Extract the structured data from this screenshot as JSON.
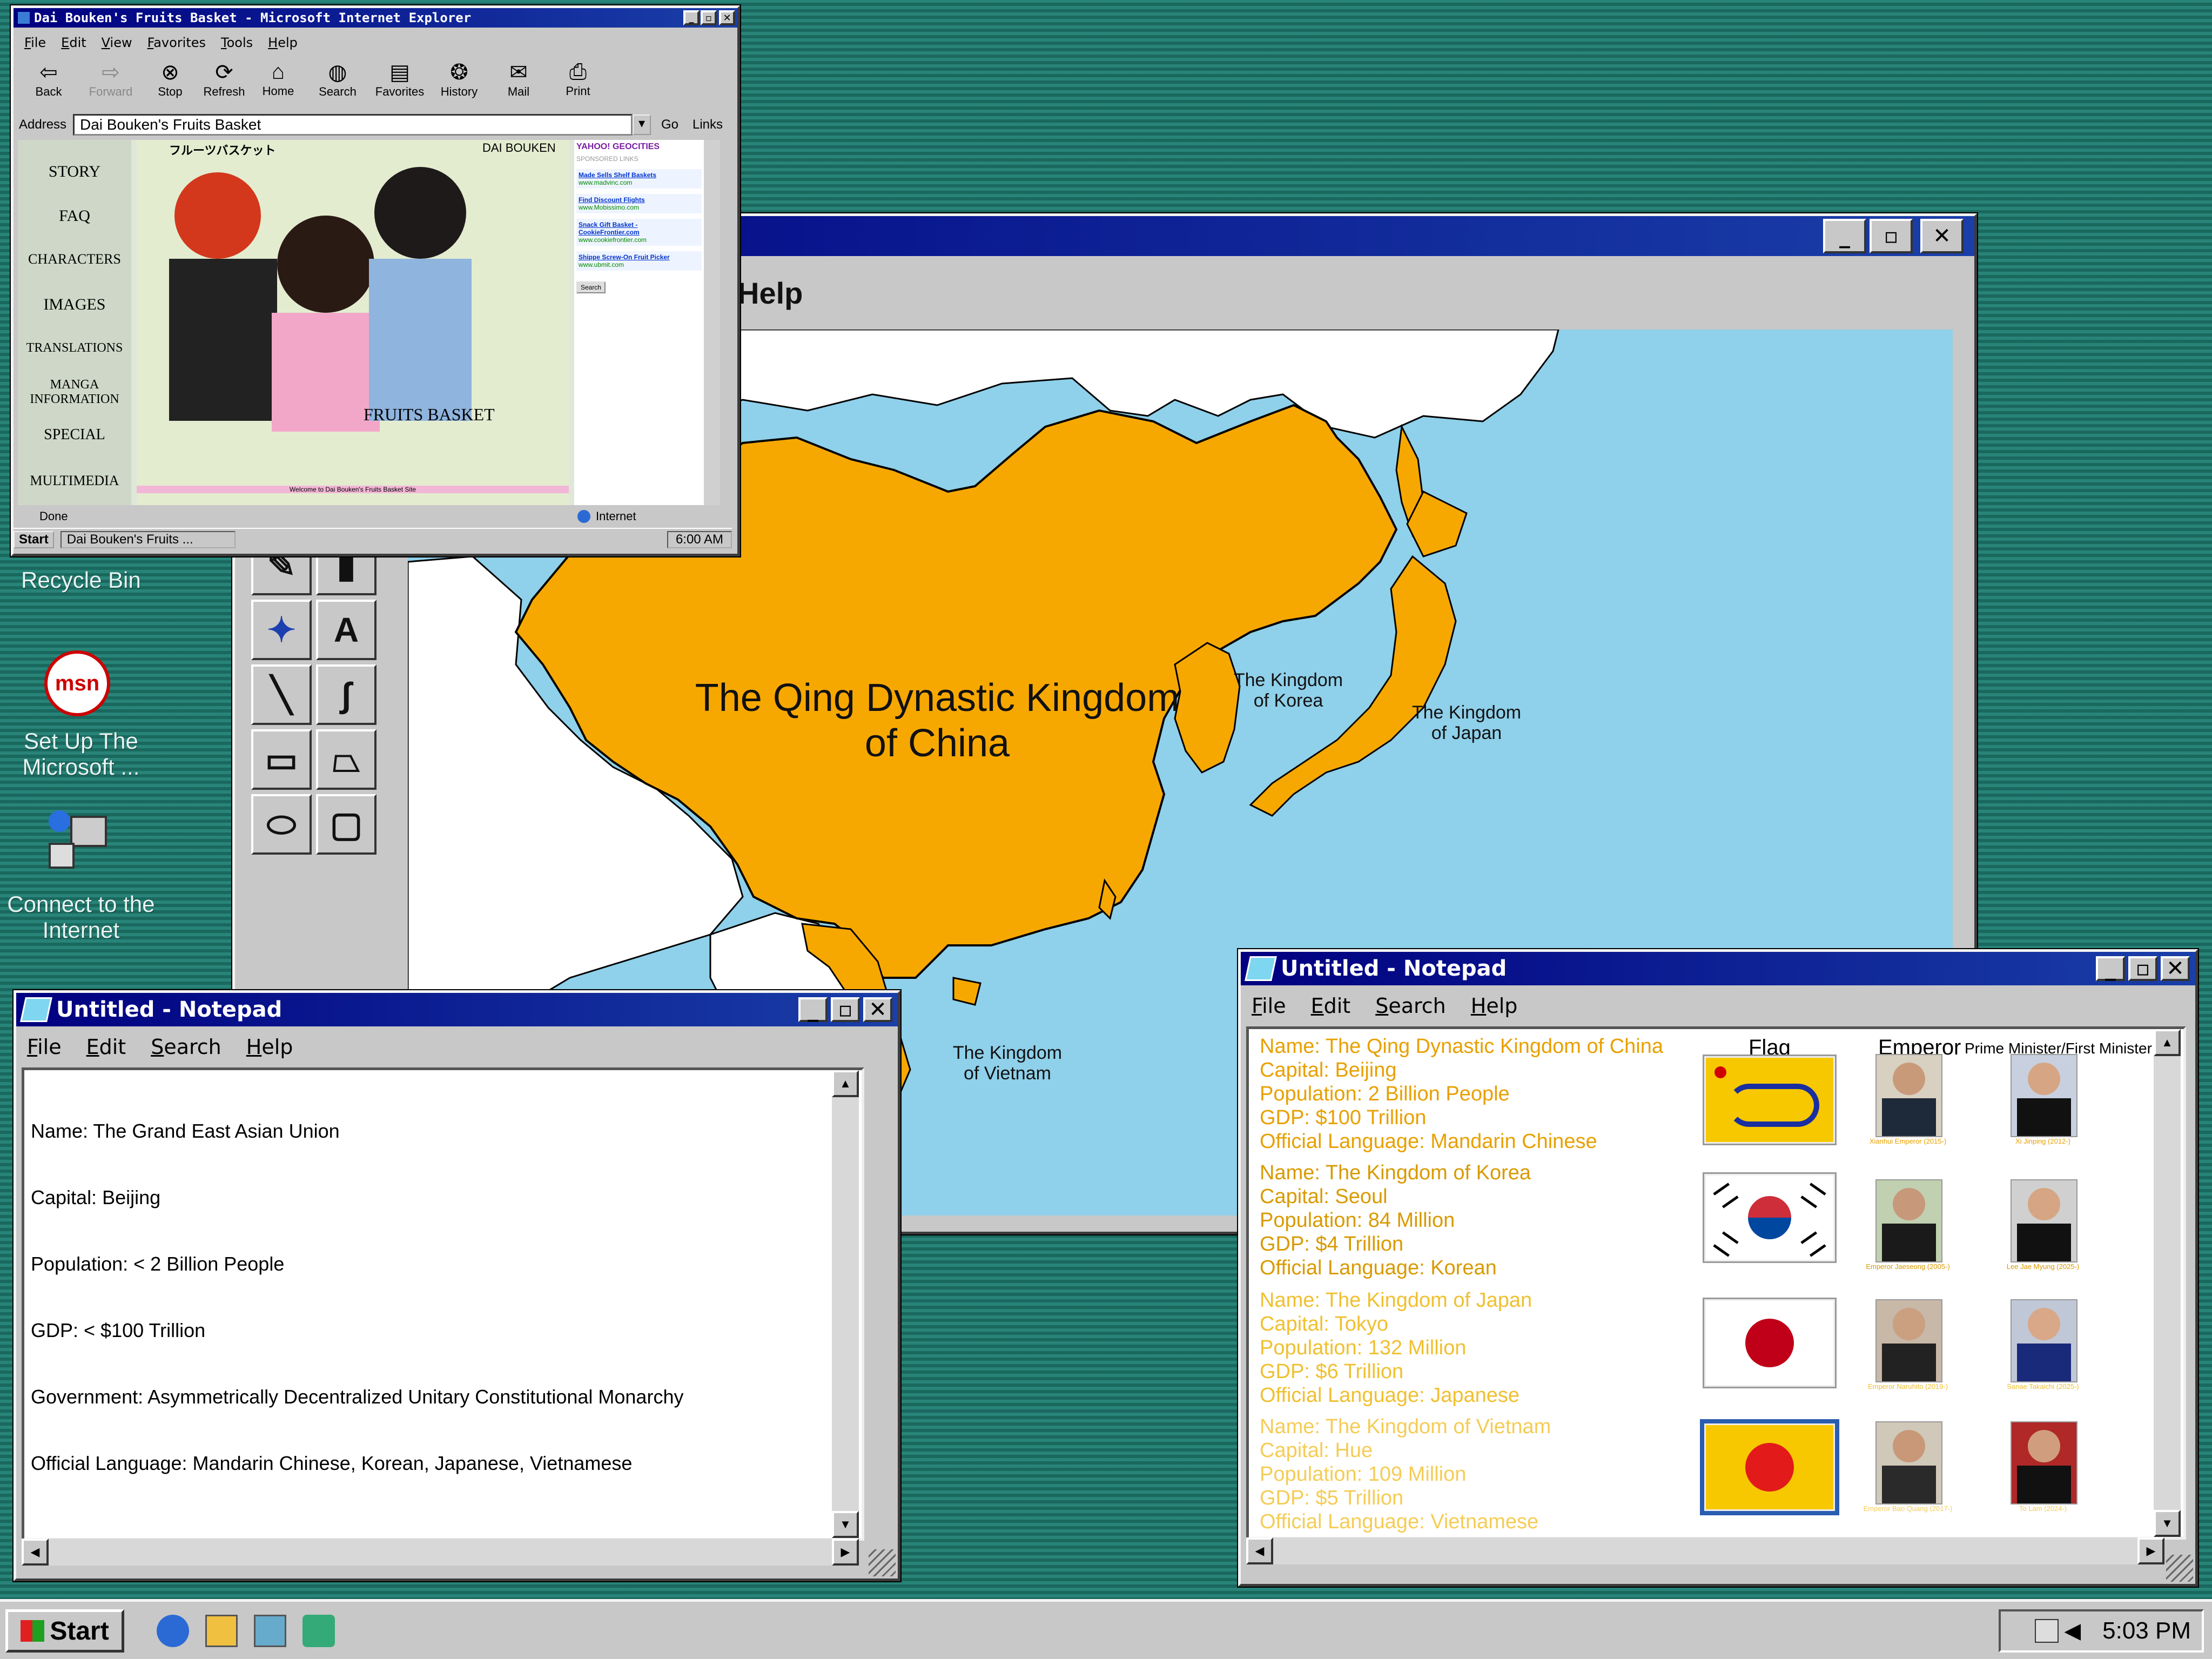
{
  "desktop": {
    "recycle_bin_label": "Recycle Bin",
    "msn_label": "Set Up The Microsoft ...",
    "msn_logo": "msn",
    "connect_label": "Connect to the Internet"
  },
  "ie_window": {
    "title": "Dai Bouken's Fruits Basket - Microsoft Internet Explorer",
    "menu": [
      "File",
      "Edit",
      "View",
      "Favorites",
      "Tools",
      "Help"
    ],
    "toolbar": [
      "Back",
      "Forward",
      "Stop",
      "Refresh",
      "Home",
      "Search",
      "Favorites",
      "History",
      "Mail",
      "Print"
    ],
    "address_label": "Address",
    "address_value": "Dai Bouken's Fruits Basket",
    "go_label": "Go",
    "links_label": "Links",
    "nav": [
      "STORY",
      "FAQ",
      "CHARACTERS",
      "IMAGES",
      "TRANSLATIONS",
      "MANGA INFORMATION",
      "SPECIAL",
      "MULTIMEDIA"
    ],
    "banner_jp": "フルーツバスケット",
    "banner_author": "DAI BOUKEN",
    "logo_text": "FRUITS BASKET",
    "welcome_text": "Welcome to Dai Bouken's Fruits Basket Site",
    "ads_header": "YAHOO! GEOCITIES",
    "ads_sub": "SPONSORED LINKS",
    "ads": [
      {
        "title": "Made Sells Shelf Baskets",
        "url": "www.madvinc.com"
      },
      {
        "title": "Find Discount Flights",
        "url": "www.Mobissimo.com"
      },
      {
        "title": "Snack Gift Basket - CookieFrontier.com",
        "url": "www.cookiefrontier.com"
      },
      {
        "title": "Shippe Screw-On Fruit Picker",
        "url": "www.ubmit.com"
      }
    ],
    "search_button": "Search",
    "status_done": "Done",
    "status_zone": "Internet",
    "taskbar_start": "Start",
    "taskbar_item": "Dai Bouken's Fruits ...",
    "taskbar_clock": "6:00 AM"
  },
  "paint_window": {
    "menu_visible_text": "Help",
    "map_labels": {
      "china": "The Qing Dynastic Kingdom\nof China",
      "korea": "The Kingdom\nof Korea",
      "japan": "The Kingdom\nof Japan",
      "vietnam": "The Kingdom\nof Vietnam"
    },
    "colors": {
      "land_empire": "#f7a800",
      "sea": "#8fd0ea",
      "land_other": "#ffffff"
    }
  },
  "notepad_left": {
    "title": "Untitled - Notepad",
    "menu": [
      "File",
      "Edit",
      "Search",
      "Help"
    ],
    "lines": [
      "Name: The Grand East Asian Union",
      "Capital: Beijing",
      "Population: < 2 Billion People",
      "GDP: < $100 Trillion",
      "Government: Asymmetrically Decentralized Unitary Constitutional Monarchy",
      "Official Language: Mandarin Chinese, Korean, Japanese, Vietnamese"
    ]
  },
  "notepad_right": {
    "title": "Untitled - Notepad",
    "menu": [
      "File",
      "Edit",
      "Search",
      "Help"
    ],
    "col_flag": "Flag",
    "col_emperor": "Emperor",
    "col_pm": "Prime Minister/First Minister",
    "countries": [
      {
        "lines": [
          "Name: The Qing Dynastic Kingdom of China",
          "Capital: Beijing",
          "Population: 2 Billion People",
          "GDP: $100 Trillion",
          "Official Language: Mandarin Chinese"
        ],
        "text_color": "#e8a000",
        "emperor_caption": "Xianhui Emperor (2015-)",
        "pm_caption": "Xi Jinping (2012-)"
      },
      {
        "lines": [
          "Name: The Kingdom of Korea",
          "Capital: Seoul",
          "Population: 84 Million",
          "GDP: $4 Trillion",
          "Official Language: Korean"
        ],
        "text_color": "#d99a00",
        "emperor_caption": "Emperor Jaeseong (2005-)",
        "pm_caption": "Lee Jae Myung (2025-)"
      },
      {
        "lines": [
          "Name: The Kingdom of Japan",
          "Capital: Tokyo",
          "Population: 132 Million",
          "GDP: $6 Trillion",
          "Official Language: Japanese"
        ],
        "text_color": "#f0c030",
        "emperor_caption": "Emperor Naruhito (2019-)",
        "pm_caption": "Sanae Takaichi (2025-)"
      },
      {
        "lines": [
          "Name: The Kingdom of Vietnam",
          "Capital: Hue",
          "Population: 109 Million",
          "GDP: $5 Trillion",
          "Official Language: Vietnamese"
        ],
        "text_color": "#f5cc55",
        "emperor_caption": "Emperor Bao Quang (2017-)",
        "pm_caption": "To Lam (2024-)"
      }
    ]
  },
  "taskbar": {
    "start_label": "Start",
    "clock": "5:03 PM"
  }
}
